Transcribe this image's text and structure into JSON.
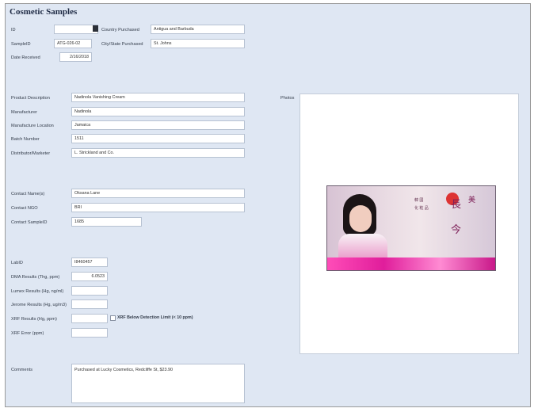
{
  "title": "Cosmetic Samples",
  "top": {
    "id_label": "ID",
    "id_value": "",
    "sampleid_label": "SampleID",
    "sampleid_value": "ATG-026-02",
    "date_label": "Date Received",
    "date_value": "2/16/2018",
    "country_label": "Country Purchased",
    "country_value": "Antigua and Barbuda",
    "city_label": "City/State Purchased",
    "city_value": "St. Johns"
  },
  "product": {
    "desc_label": "Product Description",
    "desc_value": "Nadinola Vanishing Cream",
    "mfr_label": "Manufacturer",
    "mfr_value": "Nadinola",
    "loc_label": "Manufacture Location",
    "loc_value": "Jamaica",
    "batch_label": "Batch Number",
    "batch_value": "1511",
    "dist_label": "Distributor/Marketer",
    "dist_value": "L. Strickland and Co."
  },
  "contact": {
    "name_label": "Contact Name(s)",
    "name_value": "Oksana Lane",
    "ngo_label": "Contact NGO",
    "ngo_value": "BRI",
    "sample_label": "Contact SampleID",
    "sample_value": "1685"
  },
  "lab": {
    "labid_label": "LabID",
    "labid_value": "I8460457",
    "dma_label": "DMA Results (Thg, ppm)",
    "dma_value": "6.0523",
    "lumex_label": "Lumex Results (Hg, ng/ml)",
    "lumex_value": "",
    "jerome_label": "Jerome Results (Hg, ug/m3)",
    "jerome_value": "",
    "xrf_label": "XRF Results (Hg, ppm)",
    "xrf_value": "",
    "xrf_below_label": "XRF Below Detection Limit (< 10 ppm)",
    "xrf_error_label": "XRF Error (ppm)",
    "xrf_error_value": ""
  },
  "photos_label": "Photos",
  "comments_label": "Comments",
  "comments_value": "Purchased at Lucky Cosmetics, Redcliffe St, $23.90",
  "colors": {
    "panel_bg": "#dfe7f3",
    "field_border": "#b7c2d2",
    "accent_pink": "#e01d9b"
  }
}
